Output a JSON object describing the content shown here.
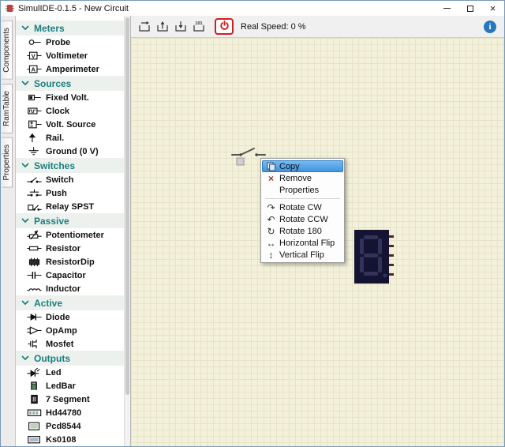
{
  "window": {
    "title": "SimulIDE-0.1.5 - New Circuit"
  },
  "side_tabs": [
    {
      "label": "Components"
    },
    {
      "label": "RamTable"
    },
    {
      "label": "Properties"
    }
  ],
  "palette": {
    "categories": [
      {
        "label": "Meters",
        "items": [
          {
            "label": "Probe",
            "icon": "probe-icon"
          },
          {
            "label": "Voltimeter",
            "icon": "voltimeter-icon"
          },
          {
            "label": "Amperimeter",
            "icon": "amperimeter-icon"
          }
        ]
      },
      {
        "label": "Sources",
        "items": [
          {
            "label": "Fixed Volt.",
            "icon": "fixed-volt-icon"
          },
          {
            "label": "Clock",
            "icon": "clock-icon"
          },
          {
            "label": "Volt. Source",
            "icon": "volt-source-icon"
          },
          {
            "label": "Rail.",
            "icon": "rail-icon"
          },
          {
            "label": "Ground (0 V)",
            "icon": "ground-icon"
          }
        ]
      },
      {
        "label": "Switches",
        "items": [
          {
            "label": "Switch",
            "icon": "switch-icon"
          },
          {
            "label": "Push",
            "icon": "push-icon"
          },
          {
            "label": "Relay SPST",
            "icon": "relay-icon"
          }
        ]
      },
      {
        "label": "Passive",
        "items": [
          {
            "label": "Potentiometer",
            "icon": "potentiometer-icon"
          },
          {
            "label": "Resistor",
            "icon": "resistor-icon"
          },
          {
            "label": "ResistorDip",
            "icon": "resistordip-icon"
          },
          {
            "label": "Capacitor",
            "icon": "capacitor-icon"
          },
          {
            "label": "Inductor",
            "icon": "inductor-icon"
          }
        ]
      },
      {
        "label": "Active",
        "items": [
          {
            "label": "Diode",
            "icon": "diode-icon"
          },
          {
            "label": "OpAmp",
            "icon": "opamp-icon"
          },
          {
            "label": "Mosfet",
            "icon": "mosfet-icon"
          }
        ]
      },
      {
        "label": "Outputs",
        "items": [
          {
            "label": "Led",
            "icon": "led-icon"
          },
          {
            "label": "LedBar",
            "icon": "ledbar-icon"
          },
          {
            "label": "7 Segment",
            "icon": "seven-segment-icon"
          },
          {
            "label": "Hd44780",
            "icon": "hd44780-icon"
          },
          {
            "label": "Pcd8544",
            "icon": "pcd8544-icon"
          },
          {
            "label": "Ks0108",
            "icon": "ks0108-icon"
          }
        ]
      }
    ]
  },
  "toolbar": {
    "buttons": [
      {
        "icon": "new-circuit-icon"
      },
      {
        "icon": "open-circuit-icon"
      },
      {
        "icon": "save-circuit-icon"
      },
      {
        "icon": "load-firmware-icon"
      }
    ],
    "power_label_icon": "power-icon",
    "real_speed_label": "Real Speed: 0 %",
    "info_glyph": "i"
  },
  "context_menu": {
    "items": [
      {
        "label": "Copy",
        "icon": "copy-icon",
        "highlighted": true
      },
      {
        "label": "Remove",
        "icon": "remove-icon",
        "glyph": "×"
      },
      {
        "label": "Properties",
        "icon": ""
      },
      {
        "type": "separator"
      },
      {
        "label": "Rotate CW",
        "icon": "rotate-cw-icon",
        "glyph": "↷"
      },
      {
        "label": "Rotate CCW",
        "icon": "rotate-ccw-icon",
        "glyph": "↶"
      },
      {
        "label": "Rotate 180",
        "icon": "rotate-180-icon",
        "glyph": "↻"
      },
      {
        "label": "Horizontal Flip",
        "icon": "horizontal-flip-icon",
        "glyph": "↔"
      },
      {
        "label": "Vertical Flip",
        "icon": "vertical-flip-icon",
        "glyph": "↕"
      }
    ]
  },
  "canvas": {
    "components": [
      {
        "name": "switch-component",
        "type": "switch"
      },
      {
        "name": "seven-segment-display",
        "type": "seven-segment"
      }
    ]
  },
  "colors": {
    "category_text": "#1a7f7f",
    "canvas_bg": "#f4f1da",
    "canvas_grid": "#e6e3ca",
    "menu_highlight": "#4293dd",
    "power_red": "#cc2020",
    "info_blue": "#2678be"
  }
}
